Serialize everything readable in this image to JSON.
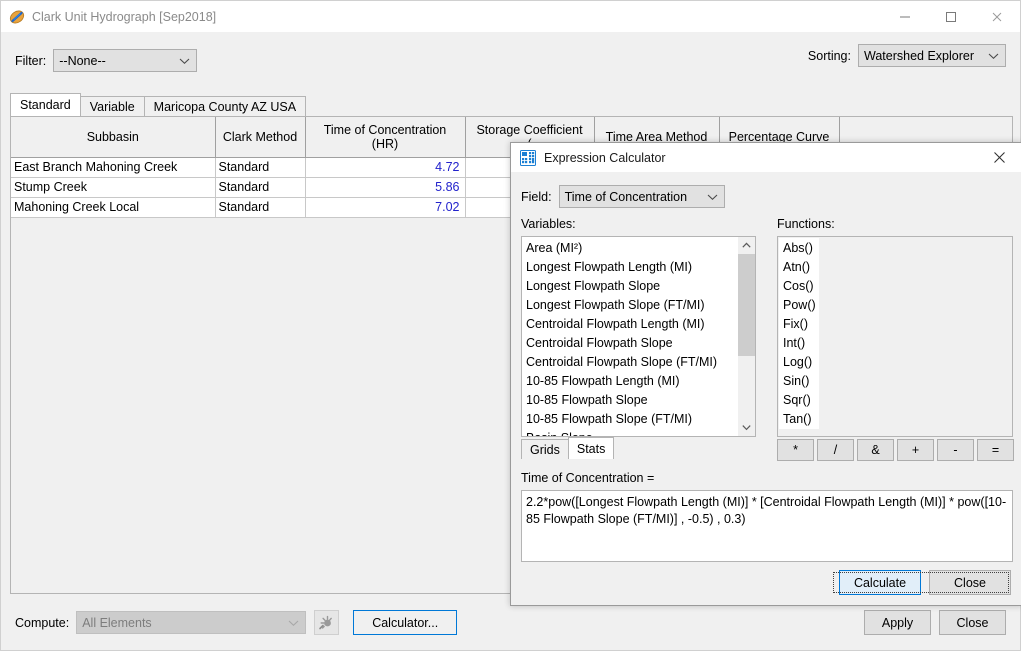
{
  "window": {
    "title": "Clark Unit Hydrograph [Sep2018]",
    "app_icon": "leaf-icon",
    "controls": {
      "minimize": "minimize-icon",
      "maximize": "maximize-icon",
      "close": "close-icon"
    }
  },
  "filter": {
    "label": "Filter:",
    "value": "--None--"
  },
  "sorting": {
    "label": "Sorting:",
    "value": "Watershed Explorer"
  },
  "tabs": [
    {
      "label": "Standard",
      "selected": true
    },
    {
      "label": "Variable",
      "selected": false
    },
    {
      "label": "Maricopa County AZ USA",
      "selected": false
    }
  ],
  "table": {
    "columns": [
      "Subbasin",
      "Clark Method",
      "Time of Concentration\n(HR)",
      "Storage Coefficient",
      "Time Area Method",
      "Percentage Curve"
    ],
    "column_headers": [
      {
        "line1": "Subbasin",
        "line2": ""
      },
      {
        "line1": "Clark Method",
        "line2": ""
      },
      {
        "line1": "Time of Concentration",
        "line2": "(HR)"
      },
      {
        "line1": "Storage Coefficient",
        "line2": "("
      },
      {
        "line1": "Time Area Method",
        "line2": ""
      },
      {
        "line1": "Percentage Curve",
        "line2": ""
      }
    ],
    "rows": [
      {
        "subbasin": "East Branch Mahoning Creek",
        "clark_method": "Standard",
        "time_of_concentration": "4.72",
        "storage_coefficient": "",
        "time_area_method": "",
        "percentage_curve": ""
      },
      {
        "subbasin": "Stump Creek",
        "clark_method": "Standard",
        "time_of_concentration": "5.86",
        "storage_coefficient": "",
        "time_area_method": "",
        "percentage_curve": ""
      },
      {
        "subbasin": "Mahoning Creek Local",
        "clark_method": "Standard",
        "time_of_concentration": "7.02",
        "storage_coefficient": "",
        "time_area_method": "",
        "percentage_curve": ""
      }
    ]
  },
  "bottom": {
    "compute_label": "Compute:",
    "compute_value": "All Elements",
    "compute_icon": "compute-run-icon",
    "calculator_button": "Calculator...",
    "apply_button": "Apply",
    "close_button": "Close"
  },
  "dialog": {
    "title": "Expression Calculator",
    "icon": "calculator-icon",
    "close_icon": "close-icon",
    "field_label": "Field:",
    "field_value": "Time of Concentration",
    "variables_label": "Variables:",
    "functions_label": "Functions:",
    "variables": [
      "Area (MI²)",
      "Longest Flowpath Length (MI)",
      "Longest Flowpath Slope",
      "Longest Flowpath Slope (FT/MI)",
      "Centroidal Flowpath Length (MI)",
      "Centroidal Flowpath Slope",
      "Centroidal Flowpath Slope (FT/MI)",
      "10-85 Flowpath Length (MI)",
      "10-85 Flowpath Slope",
      "10-85 Flowpath Slope (FT/MI)",
      "Basin Slope"
    ],
    "functions": [
      "Abs()",
      "Atn()",
      "Cos()",
      "Pow()",
      "Fix()",
      "Int()",
      "Log()",
      "Sin()",
      "Sqr()",
      "Tan()"
    ],
    "inner_tabs": [
      {
        "label": "Grids",
        "selected": false
      },
      {
        "label": "Stats",
        "selected": true
      }
    ],
    "operators": [
      "*",
      "/",
      "&",
      "+",
      "-",
      "="
    ],
    "expression_label": "Time of Concentration =",
    "expression": "2.2*pow([Longest Flowpath Length (MI)] * [Centroidal Flowpath Length (MI)] * pow([10-85 Flowpath Slope (FT/MI)] , -0.5) , 0.3)",
    "calculate_button": "Calculate",
    "close_button": "Close"
  },
  "colors": {
    "accent": "#0078d7",
    "value_text": "#2222cc",
    "window_bg": "#f0f0f0",
    "title_text": "#8a8a8a"
  }
}
